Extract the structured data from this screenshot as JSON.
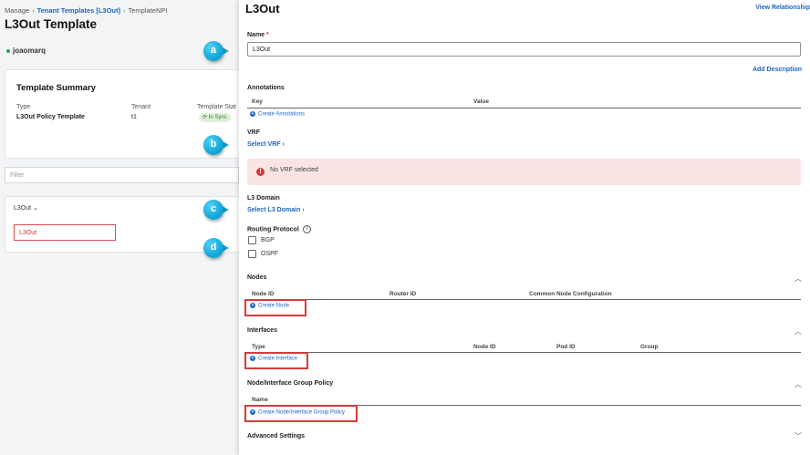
{
  "breadcrumb": {
    "manage": "Manage",
    "tenant_templates": "Tenant Templates [L3Out]",
    "template_npi": "TemplateNPI",
    "sep": "›"
  },
  "left": {
    "title": "L3Out Template",
    "user": "joaomarq",
    "summary": {
      "title": "Template Summary",
      "type_header": "Type",
      "type_value": "L3Out Policy Template",
      "tenant_header": "Tenant",
      "tenant_value": "t1",
      "status_header": "Template Stat",
      "status_value": "In Sync"
    },
    "filter_placeholder": "Filter",
    "l3out_dropdown": "L3Out",
    "l3out_item": "L3Out"
  },
  "callouts": [
    "a",
    "b",
    "c",
    "d"
  ],
  "drawer": {
    "title": "L3Out",
    "view_relationship": "View Relationship",
    "name_label": "Name",
    "required_mark": "*",
    "name_value": "L3Out",
    "add_description": "Add Description",
    "annotations": {
      "label": "Annotations",
      "col_key": "Key",
      "col_value": "Value",
      "create": "Create Annotations"
    },
    "vrf": {
      "label": "VRF",
      "select": "Select VRF",
      "alert": "No VRF selected"
    },
    "l3domain": {
      "label": "L3 Domain",
      "select": "Select L3 Domain"
    },
    "routing": {
      "label": "Routing Protocol",
      "options": [
        "BGP",
        "OSPF"
      ]
    },
    "nodes": {
      "label": "Nodes",
      "cols": [
        "Node ID",
        "Router ID",
        "Common Node Configuration"
      ],
      "create": "Create Node"
    },
    "interfaces": {
      "label": "Interfaces",
      "cols": [
        "Type",
        "Node ID",
        "Pod ID",
        "Group"
      ],
      "create": "Create Interface"
    },
    "group_policy": {
      "label": "Node/Interface Group Policy",
      "col_name": "Name",
      "create": "Create Node/Interface Group Policy"
    },
    "advanced": "Advanced Settings"
  }
}
